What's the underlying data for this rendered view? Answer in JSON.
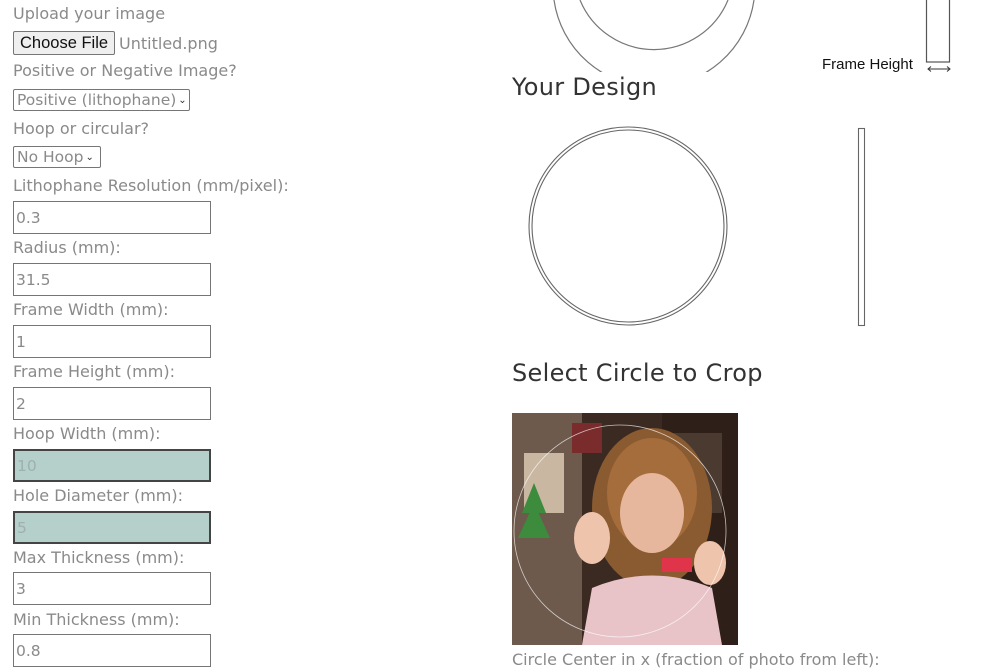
{
  "form": {
    "upload_label": "Upload your image",
    "choose_file_label": "Choose File",
    "file_name": "Untitled.png",
    "polarity_label": "Positive or Negative Image?",
    "polarity_value": "Positive (lithophane)",
    "hoop_label": "Hoop or circular?",
    "hoop_value": "No Hoop",
    "resolution_label": "Lithophane Resolution (mm/pixel):",
    "resolution_value": "0.3",
    "radius_label": "Radius (mm):",
    "radius_value": "31.5",
    "frame_width_label": "Frame Width (mm):",
    "frame_width_value": "1",
    "frame_height_label": "Frame Height (mm):",
    "frame_height_value": "2",
    "hoop_width_label": "Hoop Width (mm):",
    "hoop_width_value": "10",
    "hole_diameter_label": "Hole Diameter (mm):",
    "hole_diameter_value": "5",
    "max_thickness_label": "Max Thickness (mm):",
    "max_thickness_value": "3",
    "min_thickness_label": "Min Thickness (mm):",
    "min_thickness_value": "0.8"
  },
  "preview": {
    "frame_height_caption": "Frame Height",
    "design_heading": "Your Design",
    "crop_heading": "Select Circle to Crop",
    "circle_center_x_label": "Circle Center in x (fraction of photo from left):"
  },
  "colors": {
    "disabled_field": "#b5cfcb",
    "label_text": "#8a8a8a"
  }
}
